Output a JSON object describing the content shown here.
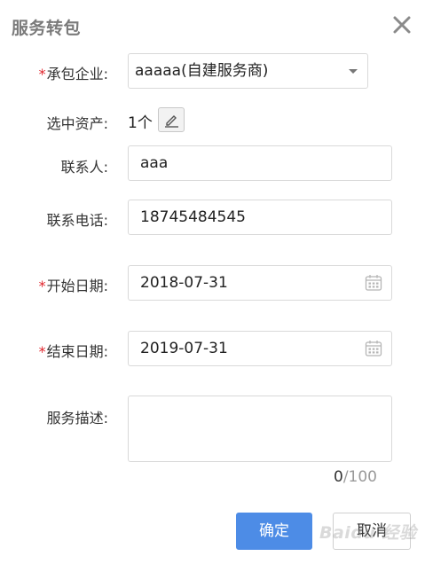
{
  "dialog": {
    "title": "服务转包",
    "close_icon": "close-icon"
  },
  "form": {
    "required_mark": "*",
    "contractor": {
      "label": "承包企业:",
      "value": "aaaaa(自建服务商)",
      "required": true
    },
    "selected_assets": {
      "label": "选中资产:",
      "count": "1个",
      "edit_icon": "edit-icon"
    },
    "contact_person": {
      "label": "联系人:",
      "value": "aaa"
    },
    "contact_phone": {
      "label": "联系电话:",
      "value": "18745484545"
    },
    "start_date": {
      "label": "开始日期:",
      "value": "2018-07-31",
      "required": true,
      "icon": "calendar-icon"
    },
    "end_date": {
      "label": "结束日期:",
      "value": "2019-07-31",
      "required": true,
      "icon": "calendar-icon"
    },
    "description": {
      "label": "服务描述:",
      "value": "",
      "char_count": "0",
      "max_chars": "/100"
    }
  },
  "buttons": {
    "confirm": "确定",
    "cancel": "取消"
  },
  "watermark": "Baidu 经验",
  "colors": {
    "primary": "#4d8ce6",
    "required": "#e0242b",
    "title": "#7a7a7a"
  }
}
